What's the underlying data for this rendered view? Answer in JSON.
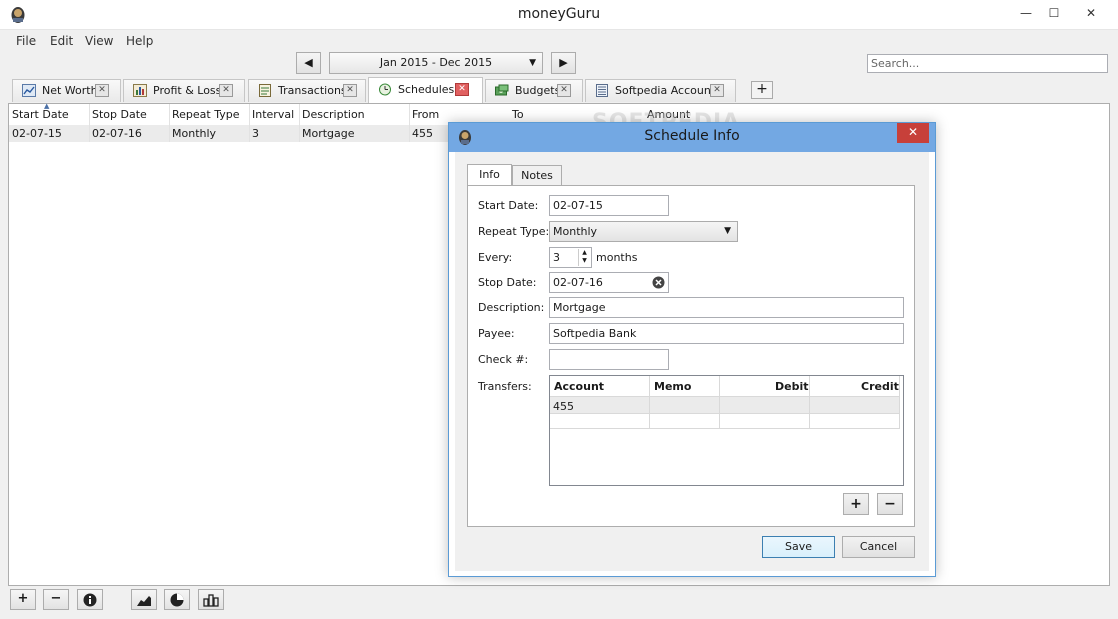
{
  "window": {
    "title": "moneyGuru",
    "minimize": "—",
    "maximize": "☐",
    "close": "✕"
  },
  "menu": [
    "File",
    "Edit",
    "View",
    "Help"
  ],
  "toolbar": {
    "prev": "◀",
    "next": "▶",
    "date_range": "Jan 2015 - Dec 2015",
    "search_placeholder": "Search..."
  },
  "tabs": [
    {
      "label": "Net Worth",
      "icon": "net-worth-icon"
    },
    {
      "label": "Profit & Loss",
      "icon": "profit-loss-icon"
    },
    {
      "label": "Transactions",
      "icon": "transactions-icon"
    },
    {
      "label": "Schedules",
      "icon": "schedules-icon",
      "active": true
    },
    {
      "label": "Budgets",
      "icon": "budgets-icon"
    },
    {
      "label": "Softpedia Account",
      "icon": "account-icon"
    }
  ],
  "tab_add": "+",
  "tab_close": "✕",
  "table": {
    "headers": [
      "Start Date",
      "Stop Date",
      "Repeat Type",
      "Interval",
      "Description",
      "From",
      "To",
      "Amount"
    ],
    "rows": [
      [
        "02-07-15",
        "02-07-16",
        "Monthly",
        "3",
        "Mortgage",
        "455",
        "",
        ""
      ]
    ]
  },
  "bottom_bar": {
    "add": "+",
    "remove": "−",
    "info": "i"
  },
  "dialog": {
    "title": "Schedule Info",
    "close": "✕",
    "tabs": [
      "Info",
      "Notes"
    ],
    "fields": {
      "start_date_label": "Start Date:",
      "start_date": "02-07-15",
      "repeat_type_label": "Repeat Type:",
      "repeat_type": "Monthly",
      "every_label": "Every:",
      "every": "3",
      "every_unit": "months",
      "stop_date_label": "Stop Date:",
      "stop_date": "02-07-16",
      "description_label": "Description:",
      "description": "Mortgage",
      "payee_label": "Payee:",
      "payee": "Softpedia Bank",
      "check_label": "Check #:",
      "check": "",
      "transfers_label": "Transfers:"
    },
    "transfers": {
      "headers": [
        "Account",
        "Memo",
        "Debit",
        "Credit"
      ],
      "rows": [
        [
          "455",
          "",
          "",
          ""
        ]
      ]
    },
    "add_split": "+",
    "remove_split": "−",
    "save": "Save",
    "cancel": "Cancel"
  },
  "watermark": "SOFTPEDIA",
  "colors": {
    "dialog_title_bg": "#73a8e3",
    "close_red": "#c7403a",
    "selected_row": "#ebebeb"
  }
}
